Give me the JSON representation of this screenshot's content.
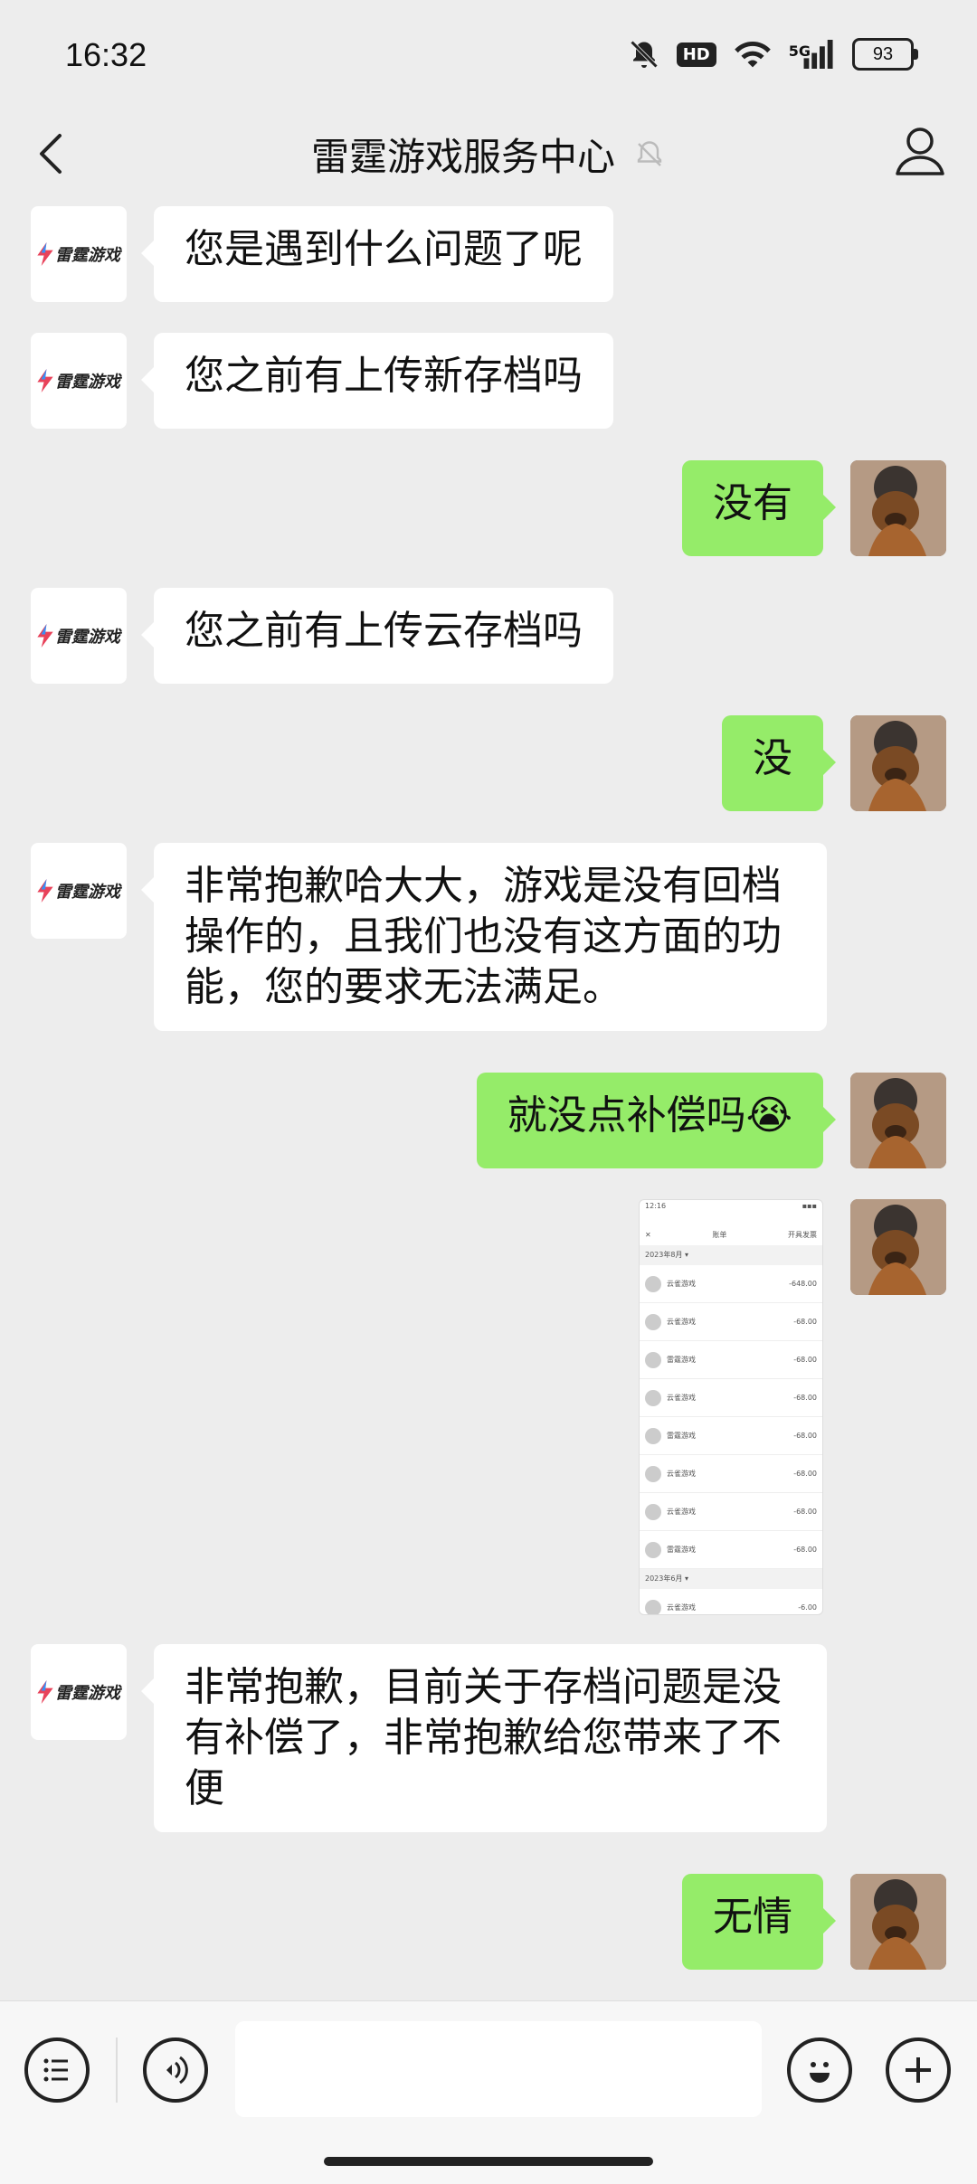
{
  "status_bar": {
    "time": "16:32",
    "hd_label": "HD",
    "network": "5G",
    "battery": "93"
  },
  "header": {
    "title": "雷霆游戏服务中心"
  },
  "brand": {
    "logo_text": "雷霆游戏"
  },
  "messages": [
    {
      "side": "in",
      "text": "您是遇到什么问题了呢"
    },
    {
      "side": "in",
      "text": "您之前有上传新存档吗"
    },
    {
      "side": "out",
      "text": "没有"
    },
    {
      "side": "in",
      "text": "您之前有上传云存档吗"
    },
    {
      "side": "out",
      "text": "没"
    },
    {
      "side": "in",
      "text": "非常抱歉哈大大，游戏是没有回档操作的，且我们也没有这方面的功能，您的要求无法满足。"
    },
    {
      "side": "out",
      "text": "就没点补偿吗😭"
    },
    {
      "side": "out",
      "type": "image"
    },
    {
      "side": "in",
      "text": "非常抱歉，目前关于存档问题是没有补偿了，非常抱歉给您带来了不便"
    },
    {
      "side": "out",
      "text": "无情"
    }
  ],
  "screenshot": {
    "time": "12:16",
    "title": "账单",
    "right": "开具发票",
    "month1": "2023年8月 ▾",
    "month2": "2023年6月 ▾",
    "items": [
      {
        "name": "云雀游戏",
        "amount": "-648.00"
      },
      {
        "name": "云雀游戏",
        "amount": "-68.00"
      },
      {
        "name": "雷霆游戏",
        "amount": "-68.00"
      },
      {
        "name": "云雀游戏",
        "amount": "-68.00"
      },
      {
        "name": "雷霆游戏",
        "amount": "-68.00"
      },
      {
        "name": "云雀游戏",
        "amount": "-68.00"
      },
      {
        "name": "云雀游戏",
        "amount": "-68.00"
      },
      {
        "name": "雷霆游戏",
        "amount": "-68.00"
      }
    ],
    "last_amount": "-6.00"
  },
  "input": {
    "value": ""
  }
}
